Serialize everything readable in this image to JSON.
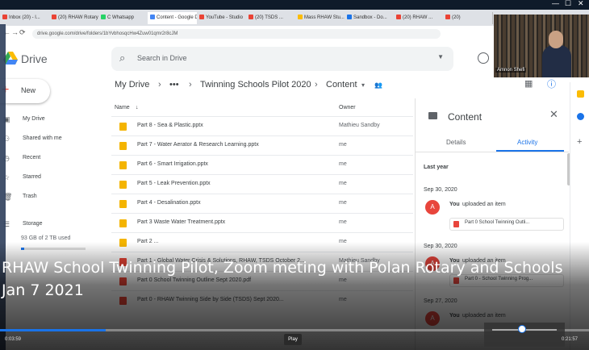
{
  "window": {
    "controls": [
      "—",
      "☐",
      "✕"
    ]
  },
  "browser": {
    "tabs": [
      {
        "label": "Inbox (20) - l...",
        "color": "#ea4335"
      },
      {
        "label": "(20) RHAW Rotary...",
        "color": "#ea4335"
      },
      {
        "label": "C Whatsapp",
        "color": "#25d366"
      },
      {
        "label": "Content - Google D...",
        "color": "#4285f4",
        "active": true
      },
      {
        "label": "YouTube - Studio",
        "color": "#ea4335"
      },
      {
        "label": "(20) TSDS ...",
        "color": "#ea4335"
      },
      {
        "label": "Mass RHAW Stu...",
        "color": "#fbbc04"
      },
      {
        "label": "Sandbox - Do...",
        "color": "#1a73e8"
      },
      {
        "label": "(20) RHAW ...",
        "color": "#ea4335"
      },
      {
        "label": "(20)",
        "color": "#ea4335"
      }
    ],
    "url": "drive.google.com/drive/folders/1bYvbhosqcHw4Zuw01qmr2r8cJM",
    "nav": [
      "←",
      "→",
      "⟳"
    ]
  },
  "drive": {
    "logo_label": "Drive",
    "search_placeholder": "Search in Drive",
    "new_label": "New",
    "sidebar": [
      {
        "icon": "▣",
        "label": "My Drive"
      },
      {
        "icon": "⚇",
        "label": "Shared with me"
      },
      {
        "icon": "◷",
        "label": "Recent"
      },
      {
        "icon": "☆",
        "label": "Starred"
      },
      {
        "icon": "🗑",
        "label": "Trash"
      },
      {
        "icon": "☰",
        "label": "Storage"
      }
    ],
    "storage": {
      "text": "93 GB of 2 TB used",
      "fraction": 0.05
    },
    "breadcrumb": {
      "root": "My Drive",
      "ellipsis": "•••",
      "folder": "Twinning Schools Pilot 2020",
      "current": "Content"
    },
    "columns": {
      "name": "Name",
      "owner": "Owner"
    },
    "files": [
      {
        "name": "Part 8 - Sea & Plastic.pptx",
        "owner": "Mathieu Sandby",
        "color": "#f4b400",
        "shared": true
      },
      {
        "name": "Part 7 - Water Aerator & Research Learning.pptx",
        "owner": "me",
        "color": "#f4b400",
        "shared": true
      },
      {
        "name": "Part 6 - Smart Irrigation.pptx",
        "owner": "me",
        "color": "#f4b400",
        "shared": true
      },
      {
        "name": "Part 5 - Leak Prevention.pptx",
        "owner": "me",
        "color": "#f4b400",
        "shared": true
      },
      {
        "name": "Part 4 - Desalination.pptx",
        "owner": "me",
        "color": "#f4b400",
        "shared": true
      },
      {
        "name": "Part 3 Waste Water Treatment.pptx",
        "owner": "me",
        "color": "#f4b400",
        "shared": true
      },
      {
        "name": "Part 2 ...",
        "owner": "me",
        "color": "#f4b400",
        "shared": true
      },
      {
        "name": "Part 1 - Global Water Crisis & Solutions, RHAW, TSDS October 2...",
        "owner": "Mathieu Sandby",
        "color": "#ea4335",
        "shared": true
      },
      {
        "name": "Part 0 School Twinning Outline Sept 2020.pdf",
        "owner": "me",
        "color": "#ea4335",
        "shared": true
      },
      {
        "name": "Part 0 - RHAW Twinning Side by Side (TSDS) Sept 2020...",
        "owner": "me",
        "color": "#ea4335",
        "shared": true
      }
    ]
  },
  "panel": {
    "title": "Content",
    "tabs": [
      "Details",
      "Activity"
    ],
    "period": "Last year",
    "events": [
      {
        "date": "Sep 30, 2020",
        "who": "You",
        "action": "uploaded an item",
        "file": "Part 0 School Twinning Outli..."
      },
      {
        "date": "Sep 30, 2020",
        "who": "You",
        "action": "uploaded an item",
        "file": "Part 0 - School Twinning Prog..."
      },
      {
        "date": "Sep 27, 2020",
        "who": "You",
        "action": "uploaded an item",
        "file": ""
      }
    ]
  },
  "webcam": {
    "name": "Amnon Shefi"
  },
  "video": {
    "title": "RHAW School Twinning Pilot, Zoom meting with Polan Rotary and Schools Jan 7 2021",
    "time_current": "0:03:59",
    "time_total": "0:21:57",
    "play_label": "Play",
    "progress": 0.18
  }
}
